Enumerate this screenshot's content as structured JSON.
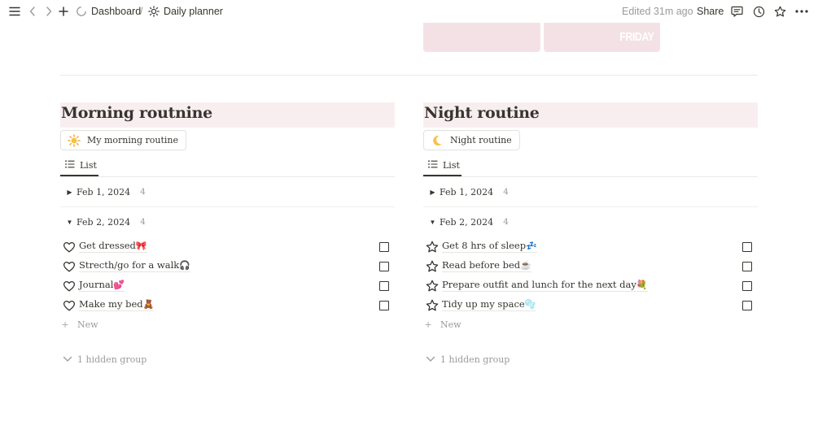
{
  "topbar": {
    "breadcrumb": [
      {
        "icon": "dashboard-icon",
        "label": "Dashboard"
      },
      {
        "icon": "sun-icon",
        "label": "Daily planner"
      }
    ],
    "separator": "/",
    "edited": "Edited 31m ago",
    "share_label": "Share"
  },
  "cover": {
    "card2_label": "FRIDAY",
    "card_color": "#f4e1e6"
  },
  "columns": [
    {
      "title": "Morning routnine",
      "link": {
        "emoji": "sun-icon",
        "label": "My morning routine"
      },
      "view_tab": "List",
      "groups": [
        {
          "date": "Feb 1, 2024",
          "count": "4",
          "expanded": false
        },
        {
          "date": "Feb 2, 2024",
          "count": "4",
          "expanded": true
        }
      ],
      "item_icon": "heart-icon",
      "items": [
        {
          "text": "Get dressed",
          "emoji": "🎀"
        },
        {
          "text": "Strecth/go for a walk",
          "emoji": "🎧"
        },
        {
          "text": "Journal",
          "emoji": "💕"
        },
        {
          "text": "Make my bed",
          "emoji": "🧸"
        }
      ],
      "new_label": "New",
      "hidden_label": "1 hidden group"
    },
    {
      "title": "Night routine",
      "link": {
        "emoji": "moon-icon",
        "label": "Night routine"
      },
      "view_tab": "List",
      "groups": [
        {
          "date": "Feb 1, 2024",
          "count": "4",
          "expanded": false
        },
        {
          "date": "Feb 2, 2024",
          "count": "4",
          "expanded": true
        }
      ],
      "item_icon": "star-icon",
      "items": [
        {
          "text": "Get 8 hrs of sleep",
          "emoji": "💤"
        },
        {
          "text": "Read before bed",
          "emoji": "☕"
        },
        {
          "text": "Prepare outfit and lunch for the next day",
          "emoji": "💐"
        },
        {
          "text": "Tidy up my space",
          "emoji": "🫧"
        }
      ],
      "new_label": "New",
      "hidden_label": "1 hidden group"
    }
  ]
}
